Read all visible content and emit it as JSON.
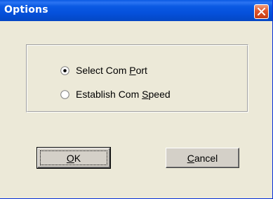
{
  "window": {
    "title": "Options"
  },
  "options": {
    "items": [
      {
        "before": "Select Com ",
        "accel": "P",
        "after": "ort",
        "selected": true
      },
      {
        "before": "Establish Com ",
        "accel": "S",
        "after": "peed",
        "selected": false
      }
    ]
  },
  "buttons": {
    "ok": {
      "accel": "O",
      "rest": "K"
    },
    "cancel": {
      "accel": "C",
      "rest": "ancel"
    }
  },
  "colors": {
    "titlebar": "#0a5ae3",
    "close": "#e0542a",
    "face": "#ece9d8"
  },
  "icons": {
    "close": "close-icon",
    "radio_on": "radio-selected-icon",
    "radio_off": "radio-unselected-icon"
  }
}
